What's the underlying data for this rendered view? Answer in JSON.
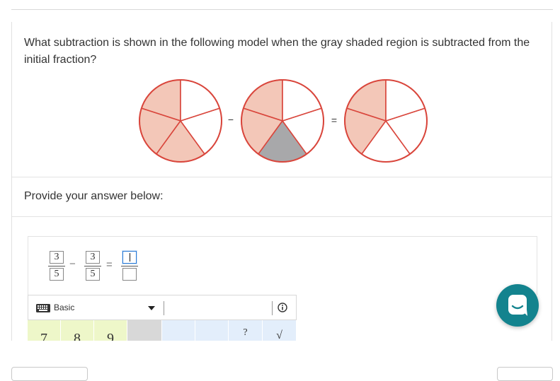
{
  "question": {
    "text": "What subtraction is shown in the following model when the gray shaded region is subtracted from the initial fraction?"
  },
  "model": {
    "minus_symbol": "−",
    "equals_symbol": "=",
    "colors": {
      "shaded": "#f3c7b8",
      "subtracted": "#a8a8aa",
      "outline": "#d9463c",
      "empty": "#ffffff"
    },
    "circles": [
      {
        "name": "initial",
        "total_parts": 5,
        "shaded_parts": 3,
        "gray_parts": 0
      },
      {
        "name": "subtracting",
        "total_parts": 5,
        "shaded_parts": 2,
        "gray_parts": 1
      },
      {
        "name": "result",
        "total_parts": 5,
        "shaded_parts": 2,
        "gray_parts": 0
      }
    ]
  },
  "answer_section": {
    "prompt": "Provide your answer below:"
  },
  "editor": {
    "fractions": [
      {
        "numerator": "3",
        "denominator": "5"
      },
      {
        "numerator": "3",
        "denominator": "5"
      }
    ],
    "operator": "−",
    "equals": "=",
    "answer": {
      "numerator": "",
      "denominator": ""
    }
  },
  "toolbar": {
    "mode_label": "Basic",
    "keyboard_icon": "keyboard-icon",
    "info_icon": "info-icon"
  },
  "keypad": {
    "keys": [
      "7",
      "8",
      "9",
      "",
      "",
      "",
      "?",
      "√"
    ],
    "colors": {
      "number": "#eef7c9",
      "operator": "#d8d8d8",
      "function": "#e3eefb"
    }
  },
  "chat": {
    "icon": "chat-bubble-icon",
    "color": "#13838e"
  }
}
